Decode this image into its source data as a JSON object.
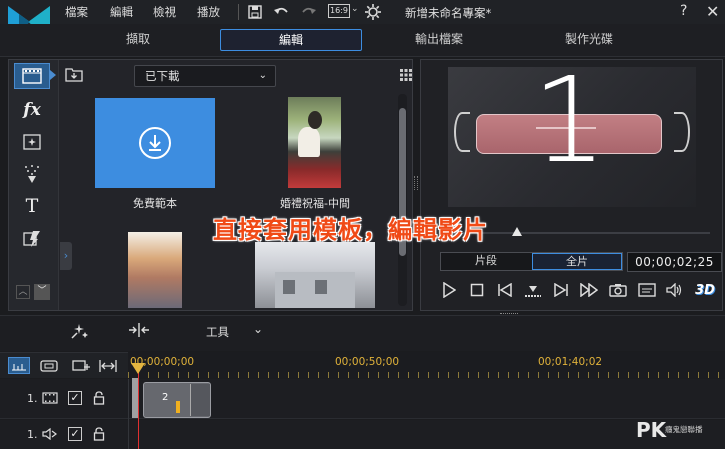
{
  "menu": {
    "items": [
      "檔案",
      "編輯",
      "檢視",
      "播放"
    ],
    "aspect_ratio": "16:9",
    "project_title": "新增未命名專案*",
    "help": "?"
  },
  "tabs": [
    {
      "label": "擷取",
      "active": false
    },
    {
      "label": "編輯",
      "active": true
    },
    {
      "label": "輸出檔案",
      "active": false
    },
    {
      "label": "製作光碟",
      "active": false
    }
  ],
  "library": {
    "filter_select": "已下載",
    "items": [
      {
        "label": "免費範本"
      },
      {
        "label": "婚禮祝福-中間"
      },
      {
        "label": ""
      },
      {
        "label": ""
      }
    ]
  },
  "preview": {
    "big_number": "1",
    "modes": [
      "片段",
      "全片"
    ],
    "active_mode": "全片",
    "timecode": "00;00;02;25",
    "badge_3d": "3D"
  },
  "caption": "直接套用模板，編輯影片",
  "toolstrip": {
    "tools_label": "工具"
  },
  "timeline": {
    "ruler": [
      "00;00;00;00",
      "00;00;50;00",
      "00;01;40;02"
    ],
    "tracks": [
      {
        "number": "1."
      },
      {
        "number": "1."
      }
    ],
    "clip_label": "2"
  },
  "watermark": {
    "logo": "PK",
    "text": "癮鬼戀聯播"
  },
  "colors": {
    "accent": "#3d8de0",
    "caption": "#f04a16",
    "ruler": "#e0b23a",
    "playhead": "#e03030"
  }
}
